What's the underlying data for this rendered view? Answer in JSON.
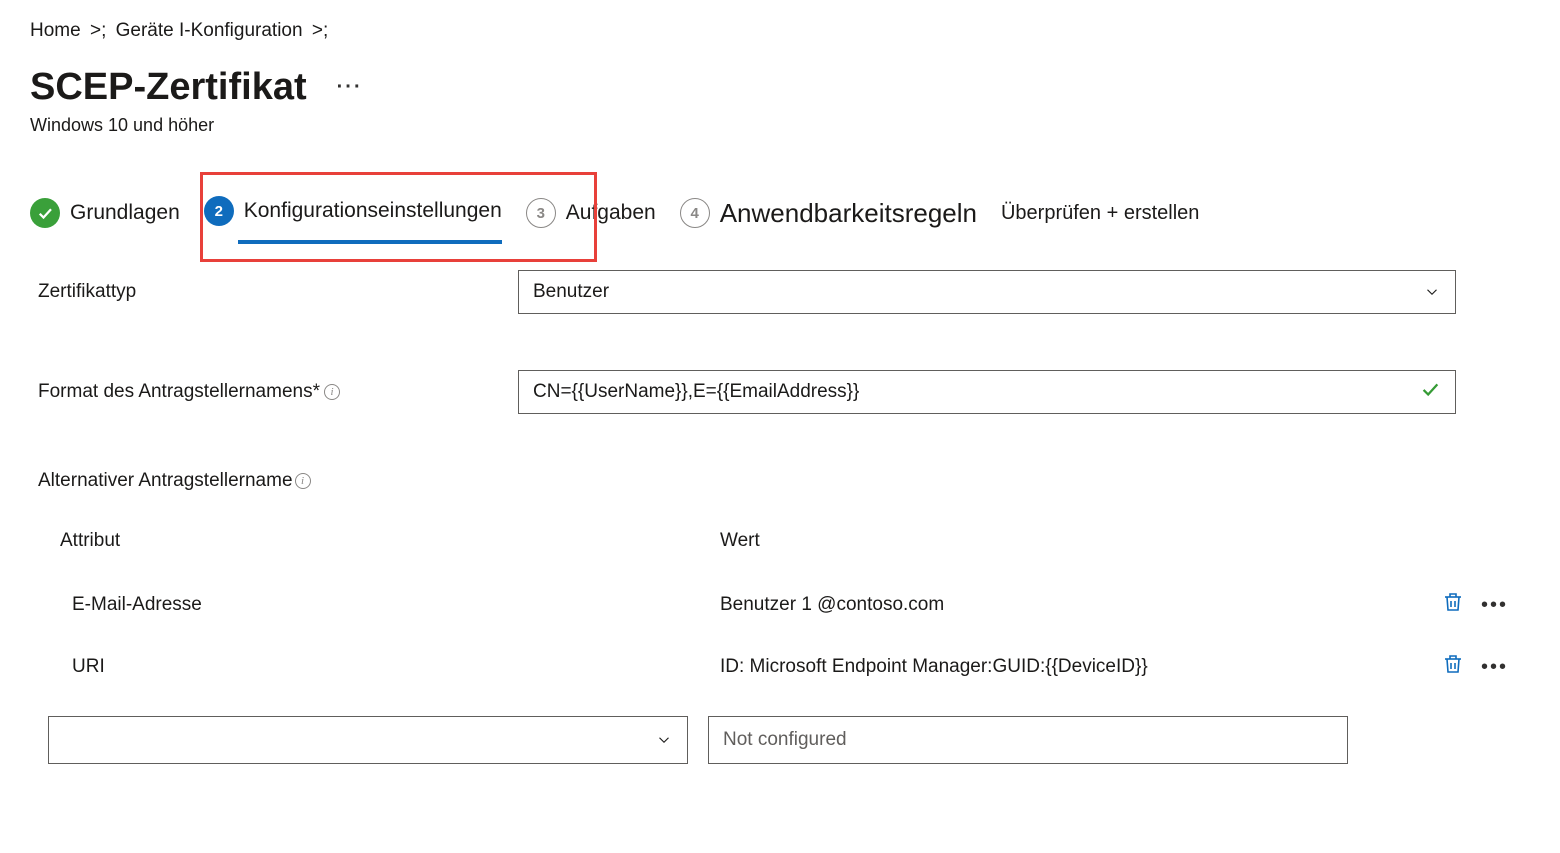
{
  "breadcrumb": {
    "items": [
      "Home",
      "Geräte I-Konfiguration"
    ],
    "sep": ">"
  },
  "page": {
    "title": "SCEP-Zertifikat",
    "subtitle": "Windows 10 und höher"
  },
  "stepper": {
    "step1": "Grundlagen",
    "step2_num": "2",
    "step2": "Konfigurationseinstellungen",
    "step3_num": "3",
    "step3": "Aufgaben",
    "step4_num": "4",
    "step4": "Anwendbarkeitsregeln",
    "step5": "Überprüfen + erstellen"
  },
  "form": {
    "cert_type_label": "Zertifikattyp",
    "cert_type_value": "Benutzer",
    "subject_format_label": "Format des Antragstellernamens*",
    "subject_format_value": "CN={{UserName}},E={{EmailAddress}}",
    "san_label": "Alternativer Antragstellername",
    "san_headers": {
      "attr": "Attribut",
      "value": "Wert"
    },
    "san_rows": [
      {
        "attr": "E-Mail-Adresse",
        "value": "Benutzer 1 @contoso.com"
      },
      {
        "attr": "URI",
        "value": "ID: Microsoft Endpoint Manager:GUID:{{DeviceID}}"
      }
    ],
    "new_row": {
      "attr_placeholder": "",
      "value_placeholder": "Not configured"
    }
  }
}
